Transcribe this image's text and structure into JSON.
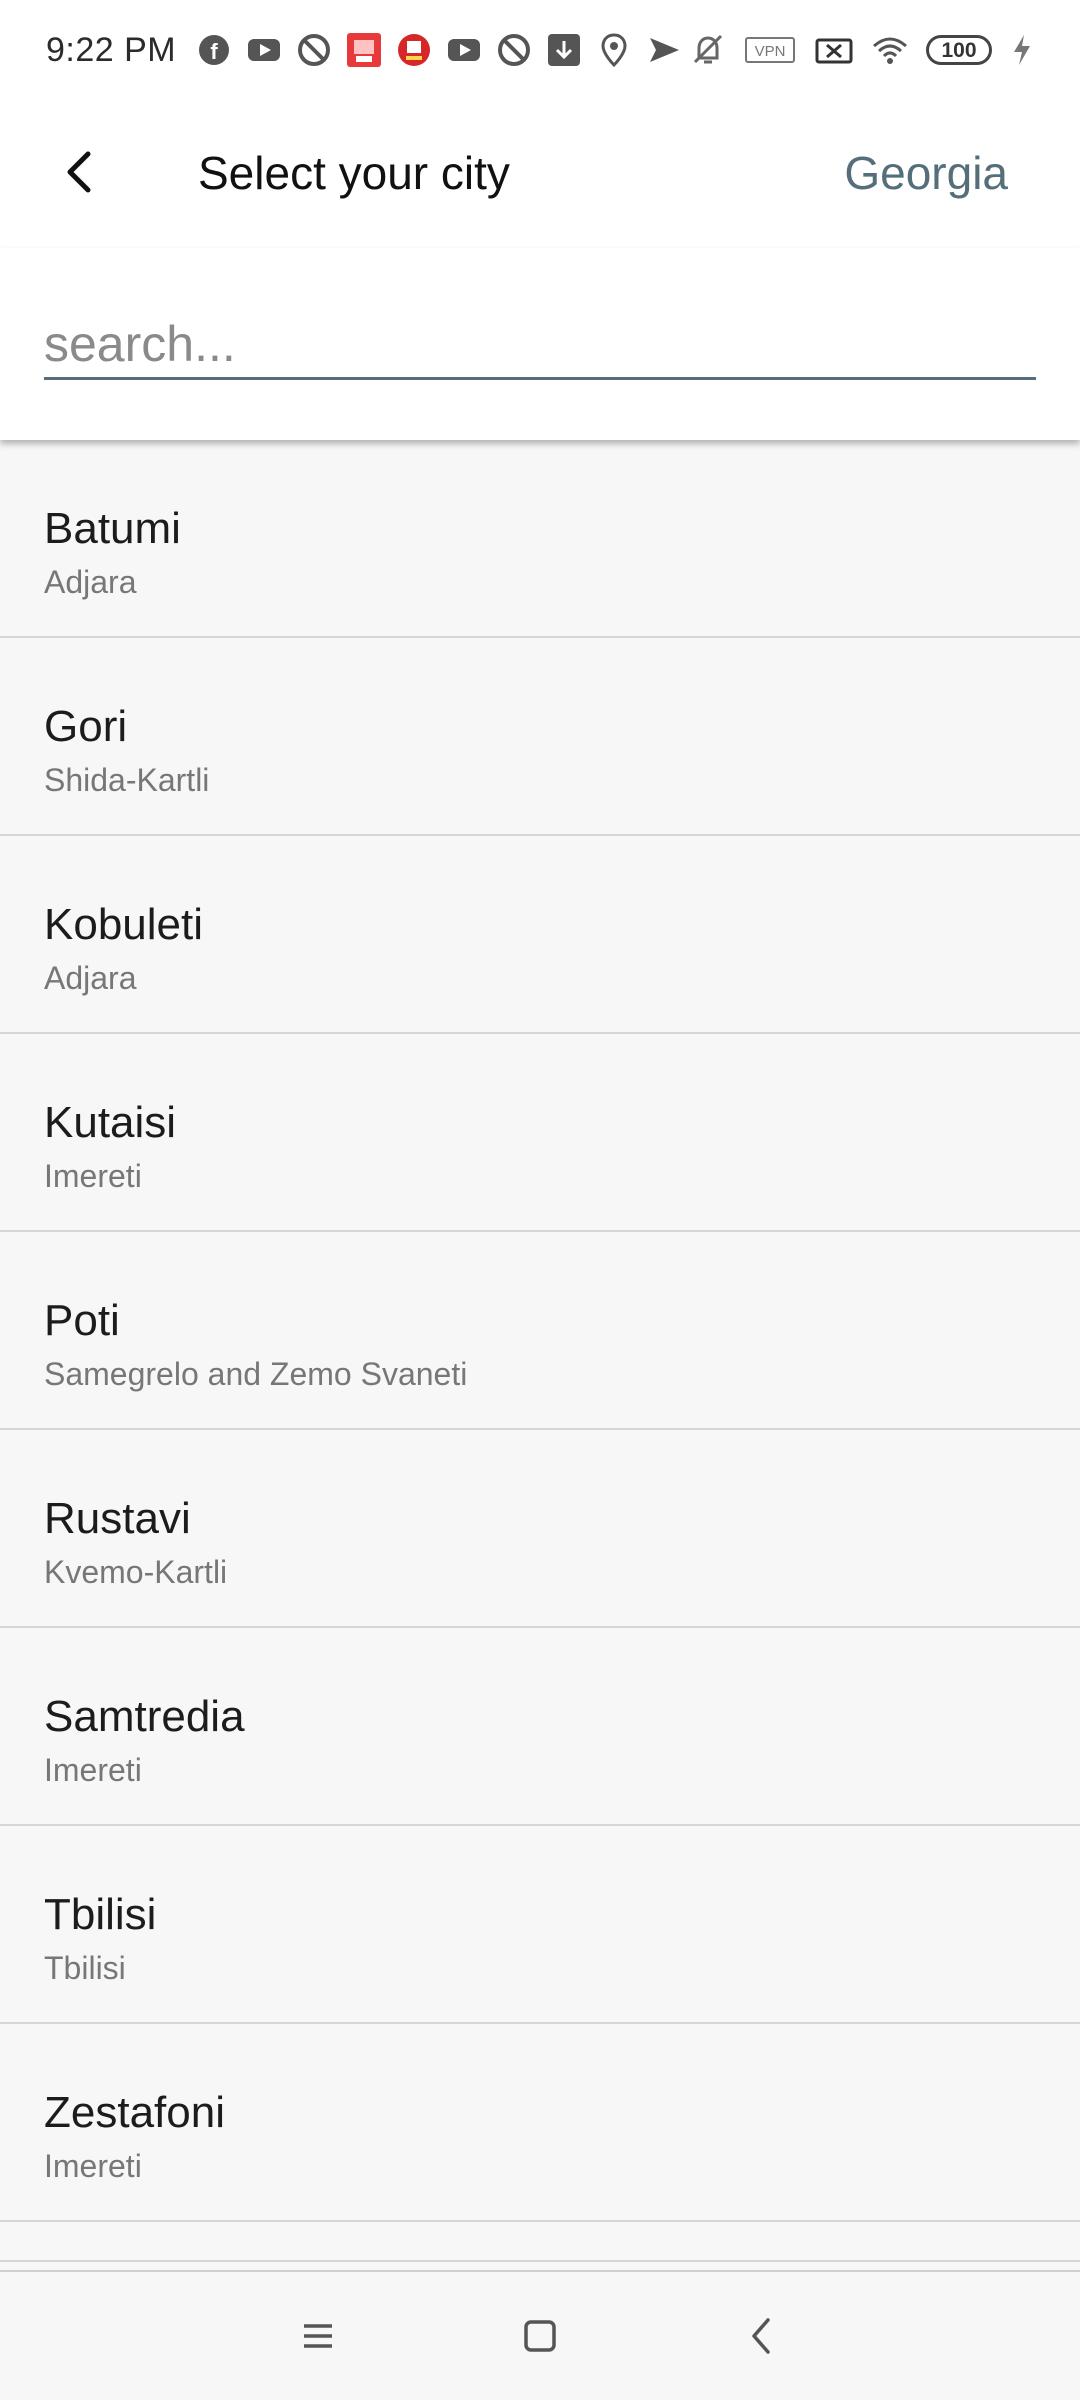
{
  "status_bar": {
    "time": "9:22 PM",
    "left_icons": [
      "facebook-icon",
      "youtube-icon",
      "blocked-icon",
      "app-promo-icon",
      "app-red-icon",
      "youtube-icon",
      "blocked-icon",
      "download-icon",
      "location-icon",
      "send-icon"
    ],
    "right_icons": [
      "mute-icon",
      "vpn-icon",
      "sim-icon",
      "wifi-icon",
      "battery-icon",
      "charging-icon"
    ],
    "vpn_label": "VPN",
    "battery_level": "100"
  },
  "header": {
    "title": "Select your city",
    "country": "Georgia",
    "accent_color": "#546e7a"
  },
  "search": {
    "placeholder": "search...",
    "value": ""
  },
  "cities": [
    {
      "name": "Batumi",
      "region": "Adjara"
    },
    {
      "name": "Gori",
      "region": "Shida-Kartli"
    },
    {
      "name": "Kobuleti",
      "region": "Adjara"
    },
    {
      "name": "Kutaisi",
      "region": "Imereti"
    },
    {
      "name": "Poti",
      "region": "Samegrelo and Zemo Svaneti"
    },
    {
      "name": "Rustavi",
      "region": "Kvemo-Kartli"
    },
    {
      "name": "Samtredia",
      "region": "Imereti"
    },
    {
      "name": "Tbilisi",
      "region": "Tbilisi"
    },
    {
      "name": "Zestafoni",
      "region": "Imereti"
    }
  ],
  "nav": {
    "buttons": [
      "menu-icon",
      "home-icon",
      "back-icon"
    ]
  }
}
